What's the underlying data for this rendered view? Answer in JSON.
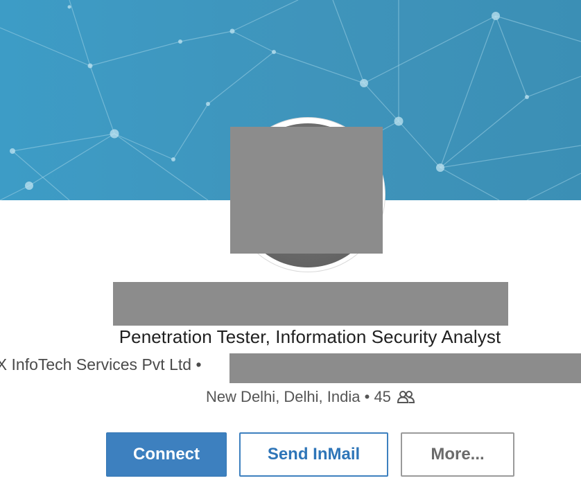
{
  "profile": {
    "headline": "Penetration Tester, Information Security Analyst",
    "company": "oX InfoTech Services Pvt Ltd",
    "company_separator": "•",
    "location": "New Delhi, Delhi, India",
    "location_separator": "•",
    "connections_count": "45",
    "connections_icon": "connections-icon"
  },
  "actions": {
    "connect_label": "Connect",
    "inmail_label": "Send InMail",
    "more_label": "More..."
  },
  "colors": {
    "banner": "#3f94bb",
    "primary_button": "#3d80bf",
    "redaction": "#8c8c8c"
  }
}
